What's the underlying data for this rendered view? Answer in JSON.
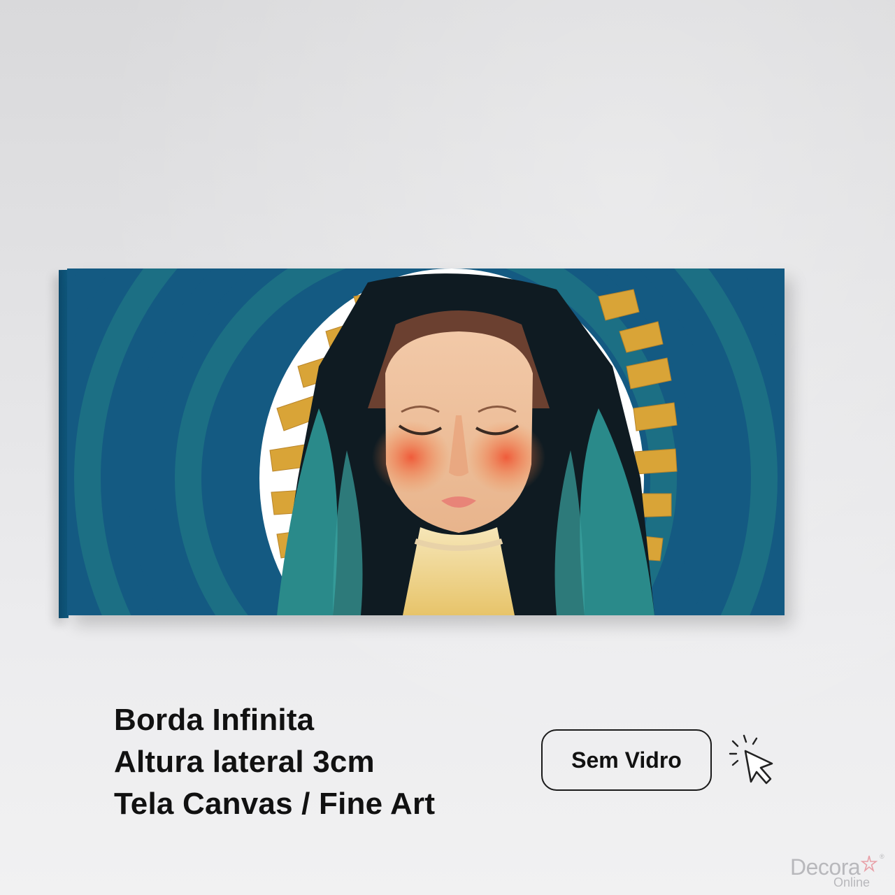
{
  "specs": {
    "line1": "Borda Infinita",
    "line2": "Altura lateral 3cm",
    "line3": "Tela Canvas / Fine Art"
  },
  "option_button": {
    "label": "Sem Vidro"
  },
  "brand": {
    "name": "Decora",
    "sub": "Online",
    "registered": "®"
  },
  "colors": {
    "canvas_blue": "#145a82",
    "canvas_teal": "#1c6f84",
    "halo_gold": "#d9a437",
    "text": "#111111",
    "brand_gray": "#b8b8bc",
    "brand_accent": "#e8a0a8"
  },
  "icons": {
    "cursor": "click-cursor-icon",
    "brand_mark": "flower-star-icon"
  }
}
